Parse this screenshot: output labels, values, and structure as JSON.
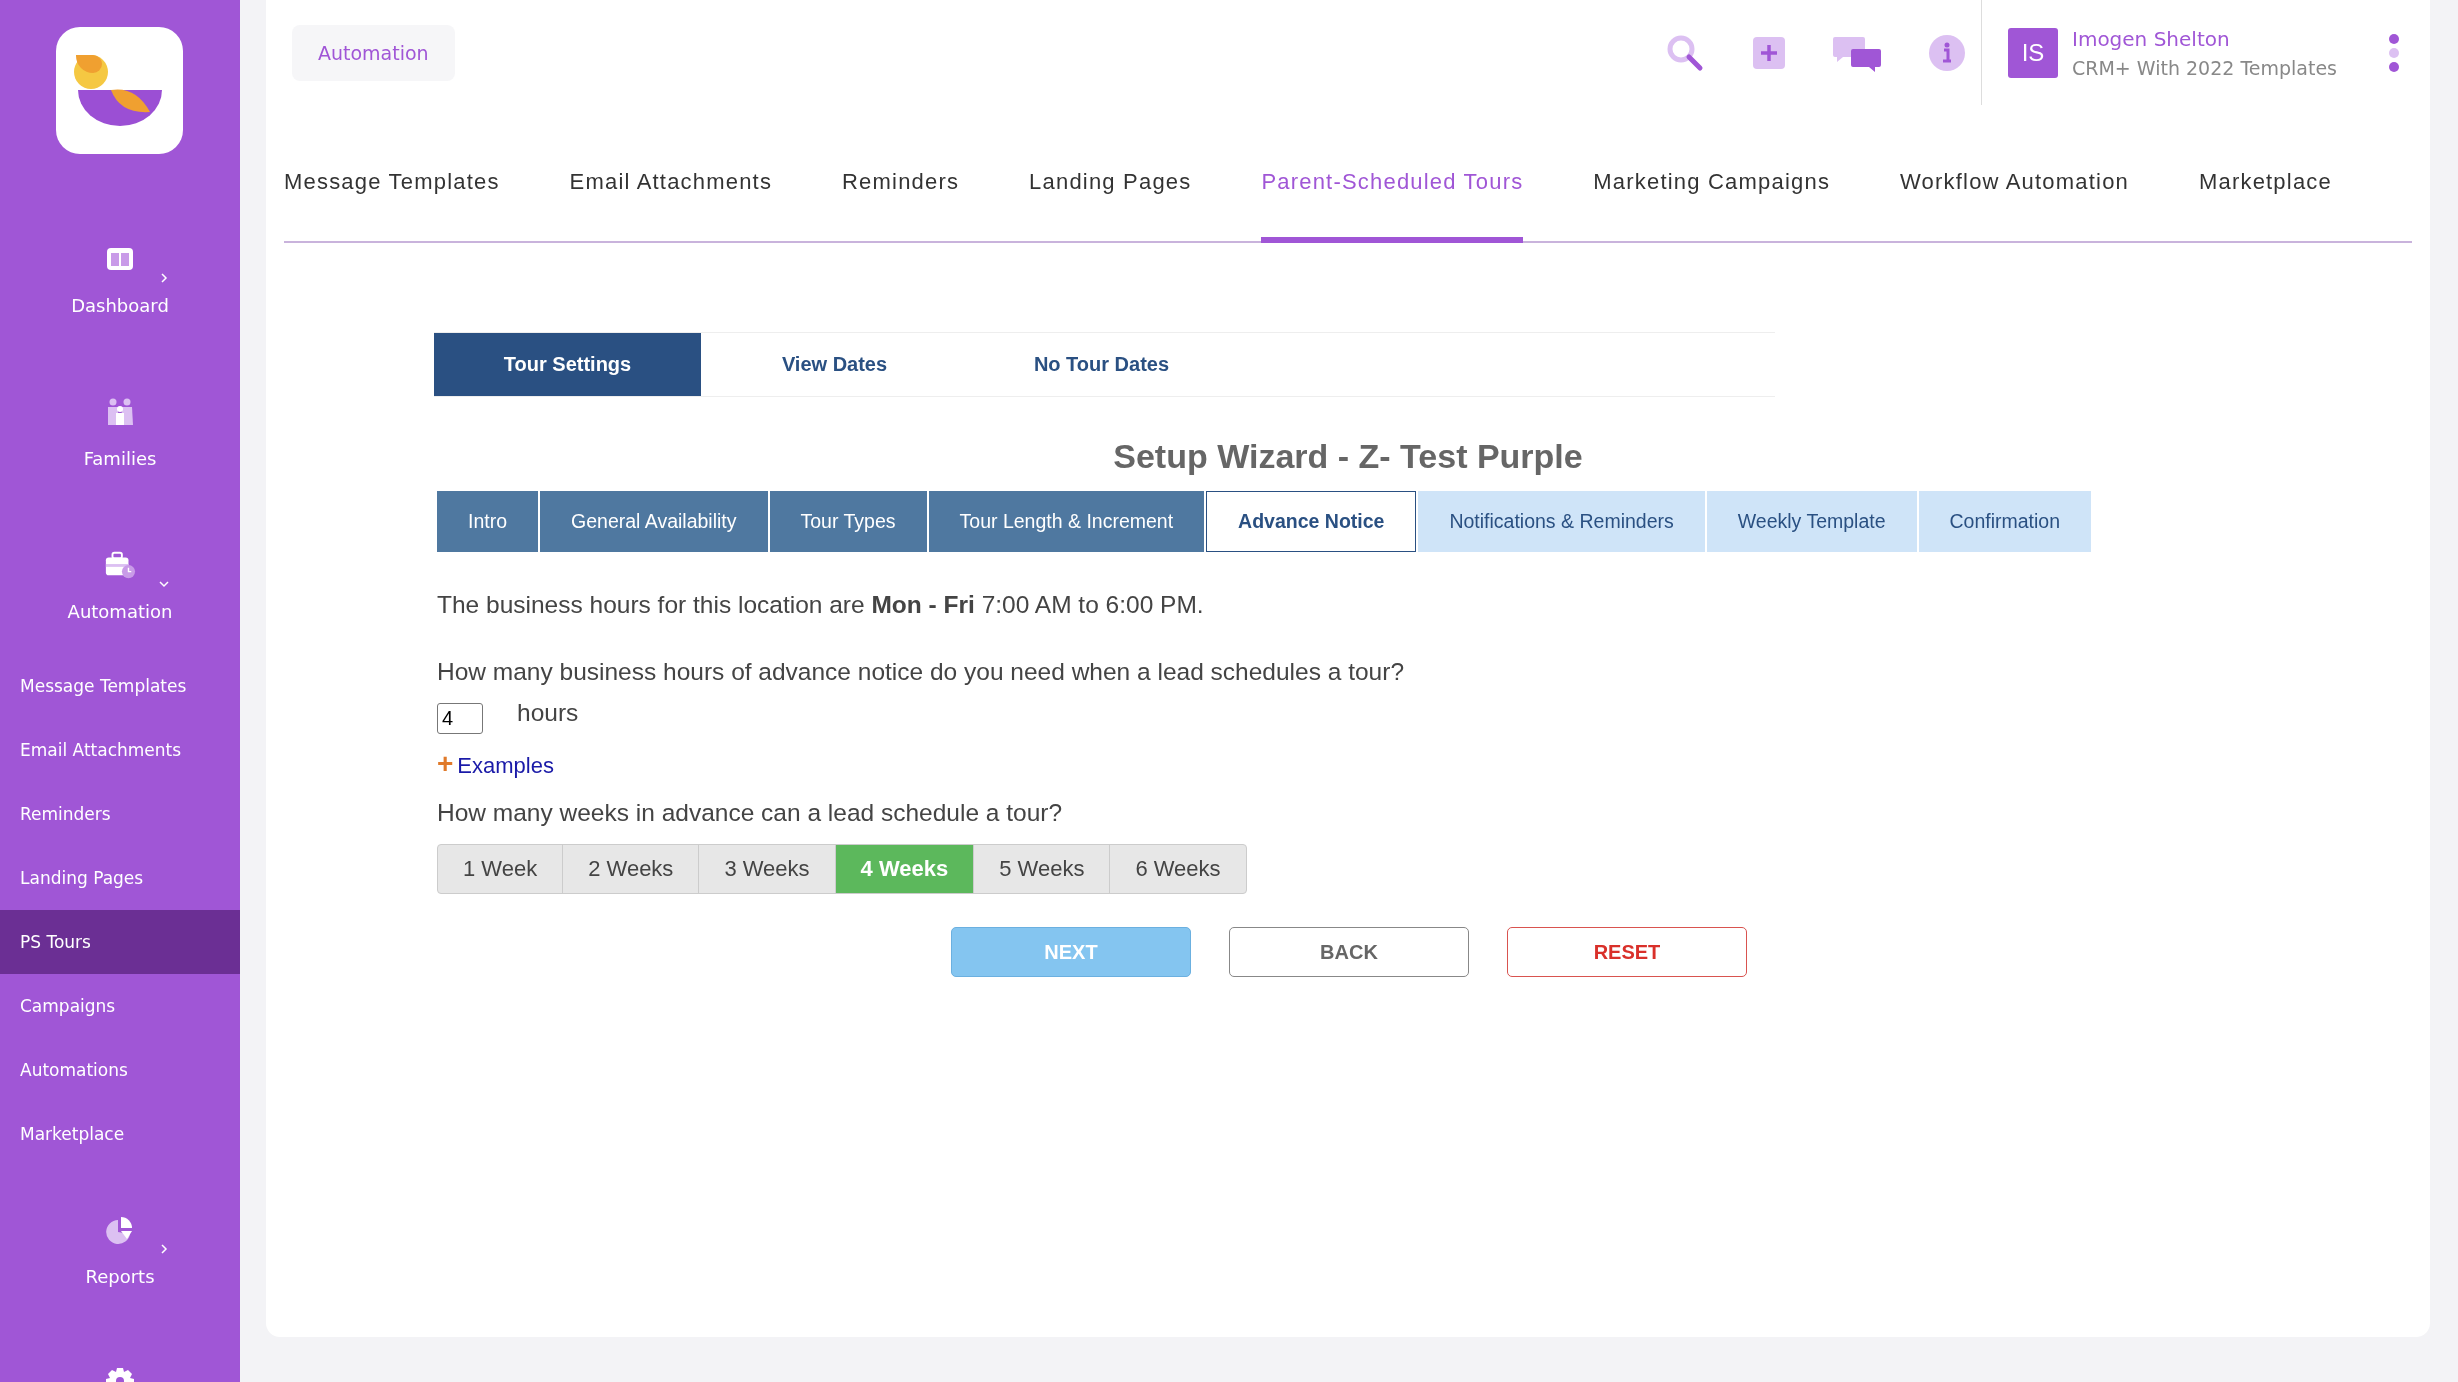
{
  "sidebar": {
    "items": [
      {
        "label": "Dashboard",
        "expanded": false
      },
      {
        "label": "Families"
      },
      {
        "label": "Automation",
        "expanded": true,
        "children": [
          {
            "label": "Message Templates",
            "selected": false
          },
          {
            "label": "Email Attachments",
            "selected": false
          },
          {
            "label": "Reminders",
            "selected": false
          },
          {
            "label": "Landing Pages",
            "selected": false
          },
          {
            "label": "PS Tours",
            "selected": true
          },
          {
            "label": "Campaigns",
            "selected": false
          },
          {
            "label": "Automations",
            "selected": false
          },
          {
            "label": "Marketplace",
            "selected": false
          }
        ]
      },
      {
        "label": "Reports",
        "expanded": false
      }
    ]
  },
  "header": {
    "breadcrumb": "Automation",
    "user": {
      "initials": "IS",
      "name": "Imogen Shelton",
      "subtitle": "CRM+ With 2022 Templates"
    }
  },
  "tabs": [
    {
      "label": "Message Templates",
      "selected": false
    },
    {
      "label": "Email Attachments",
      "selected": false
    },
    {
      "label": "Reminders",
      "selected": false
    },
    {
      "label": "Landing Pages",
      "selected": false
    },
    {
      "label": "Parent-Scheduled Tours",
      "selected": true
    },
    {
      "label": "Marketing Campaigns",
      "selected": false
    },
    {
      "label": "Workflow Automation",
      "selected": false
    },
    {
      "label": "Marketplace",
      "selected": false
    }
  ],
  "subtabs": [
    {
      "label": "Tour Settings",
      "selected": true
    },
    {
      "label": "View Dates",
      "selected": false
    },
    {
      "label": "No Tour Dates",
      "selected": false
    }
  ],
  "wizard": {
    "title": "Setup Wizard - Z- Test Purple",
    "steps": [
      {
        "label": "Intro",
        "completed": true,
        "selected": false
      },
      {
        "label": "General Availability",
        "completed": true,
        "selected": false
      },
      {
        "label": "Tour Types",
        "completed": true,
        "selected": false
      },
      {
        "label": "Tour Length & Increment",
        "completed": true,
        "selected": false
      },
      {
        "label": "Advance Notice",
        "selected": true
      },
      {
        "label": "Notifications & Reminders",
        "completed": false,
        "selected": false
      },
      {
        "label": "Weekly Template",
        "completed": false,
        "selected": false
      },
      {
        "label": "Confirmation",
        "completed": false,
        "selected": false
      }
    ]
  },
  "form": {
    "hours_text": "The business hours for this location are **Mon - Fri** 7:00 AM to 6:00 PM.",
    "notice_question": "How many business hours of advance notice do you need when a lead schedules a tour?",
    "notice_value": "4",
    "notice_unit": "hours",
    "examples_toggle": {
      "icon": "+",
      "label": "Examples"
    },
    "weeks_question": "How many weeks in advance can a lead schedule a tour?",
    "weeks": [
      {
        "label": "1 Week",
        "selected": false
      },
      {
        "label": "2 Weeks",
        "selected": false
      },
      {
        "label": "3 Weeks",
        "selected": false
      },
      {
        "label": "4 Weeks",
        "selected": true
      },
      {
        "label": "5 Weeks",
        "selected": false
      },
      {
        "label": "6 Weeks",
        "selected": false
      }
    ]
  },
  "buttons": [
    {
      "label": "NEXT",
      "kind": "primary"
    },
    {
      "label": "BACK",
      "kind": "secondary"
    },
    {
      "label": "RESET",
      "kind": "danger"
    }
  ]
}
